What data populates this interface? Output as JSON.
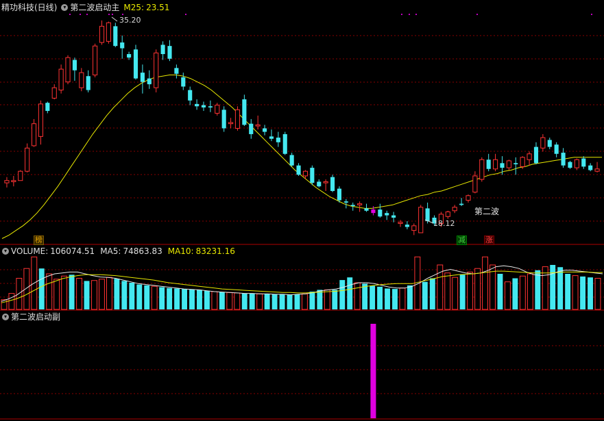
{
  "main_panel": {
    "stock_name": "精功科技(日线)",
    "indicator_name": "第二波启动主",
    "ma25_label": "M25:",
    "ma25_value": "23.51",
    "high_label": "35.20",
    "low_label": "18.12",
    "signal_text": "第二波",
    "tags": {
      "bang": "榜",
      "jian": "减",
      "zhang": "涨"
    }
  },
  "volume_panel": {
    "volume_label": "VOLUME:",
    "volume_value": "106074.51",
    "ma5_label": "MA5:",
    "ma5_value": "74863.83",
    "ma10_label": "MA10:",
    "ma10_value": "83231.16"
  },
  "sub_panel": {
    "indicator_name": "第二波启动副"
  },
  "icons": {
    "panel_toggle": "chevron-down-icon"
  },
  "colors": {
    "up": "#ff3333",
    "down": "#44e8f0",
    "ma_line": "#e8e800",
    "grid": "#8a0000",
    "signal": "#e000e0",
    "tag_bang": "#e0a000",
    "tag_jian": "#40d040",
    "tag_zhang": "#ff4040"
  },
  "chart_data": {
    "type": "candlestick",
    "price_range": [
      17.0,
      36.0
    ],
    "high": 35.2,
    "low": 18.12,
    "ma25_last": 23.51,
    "signal_index": 54,
    "candles": [
      {
        "o": 21.3,
        "h": 21.8,
        "l": 20.9,
        "c": 21.5
      },
      {
        "o": 21.4,
        "h": 21.9,
        "l": 21.0,
        "c": 21.5
      },
      {
        "o": 21.5,
        "h": 22.4,
        "l": 21.5,
        "c": 22.3
      },
      {
        "o": 22.3,
        "h": 24.7,
        "l": 22.2,
        "c": 24.3
      },
      {
        "o": 24.5,
        "h": 26.8,
        "l": 24.4,
        "c": 26.4
      },
      {
        "o": 25.3,
        "h": 28.4,
        "l": 24.6,
        "c": 28.1
      },
      {
        "o": 28.2,
        "h": 28.3,
        "l": 27.3,
        "c": 27.5
      },
      {
        "o": 28.6,
        "h": 29.8,
        "l": 28.5,
        "c": 29.5
      },
      {
        "o": 29.3,
        "h": 31.5,
        "l": 29.0,
        "c": 31.1
      },
      {
        "o": 30.0,
        "h": 32.3,
        "l": 29.8,
        "c": 32.1
      },
      {
        "o": 31.9,
        "h": 32.1,
        "l": 30.1,
        "c": 31.0
      },
      {
        "o": 29.5,
        "h": 31.2,
        "l": 29.2,
        "c": 30.8
      },
      {
        "o": 30.5,
        "h": 31.0,
        "l": 29.1,
        "c": 29.3
      },
      {
        "o": 30.6,
        "h": 33.3,
        "l": 30.4,
        "c": 33.1
      },
      {
        "o": 33.4,
        "h": 35.3,
        "l": 33.2,
        "c": 34.8
      },
      {
        "o": 33.5,
        "h": 35.2,
        "l": 33.3,
        "c": 35.1
      },
      {
        "o": 34.8,
        "h": 35.1,
        "l": 33.0,
        "c": 33.1
      },
      {
        "o": 33.4,
        "h": 34.0,
        "l": 32.0,
        "c": 32.9
      },
      {
        "o": 32.4,
        "h": 32.6,
        "l": 31.9,
        "c": 32.1
      },
      {
        "o": 32.8,
        "h": 33.2,
        "l": 30.2,
        "c": 30.3
      },
      {
        "o": 30.8,
        "h": 31.5,
        "l": 29.0,
        "c": 30.0
      },
      {
        "o": 30.3,
        "h": 31.0,
        "l": 29.4,
        "c": 29.8
      },
      {
        "o": 29.5,
        "h": 32.8,
        "l": 29.1,
        "c": 32.5
      },
      {
        "o": 33.2,
        "h": 33.5,
        "l": 31.9,
        "c": 32.4
      },
      {
        "o": 33.1,
        "h": 33.6,
        "l": 31.8,
        "c": 32.0
      },
      {
        "o": 31.2,
        "h": 31.5,
        "l": 30.3,
        "c": 30.7
      },
      {
        "o": 30.4,
        "h": 30.8,
        "l": 29.3,
        "c": 29.6
      },
      {
        "o": 29.3,
        "h": 29.6,
        "l": 28.0,
        "c": 28.4
      },
      {
        "o": 28.1,
        "h": 28.5,
        "l": 27.6,
        "c": 27.9
      },
      {
        "o": 28.0,
        "h": 28.3,
        "l": 27.5,
        "c": 27.8
      },
      {
        "o": 27.9,
        "h": 28.4,
        "l": 27.4,
        "c": 27.8
      },
      {
        "o": 27.3,
        "h": 28.2,
        "l": 27.1,
        "c": 28.0
      },
      {
        "o": 27.6,
        "h": 27.9,
        "l": 25.7,
        "c": 26.0
      },
      {
        "o": 26.4,
        "h": 26.9,
        "l": 26.0,
        "c": 26.5
      },
      {
        "o": 26.0,
        "h": 27.9,
        "l": 25.8,
        "c": 27.6
      },
      {
        "o": 28.5,
        "h": 28.9,
        "l": 26.2,
        "c": 26.3
      },
      {
        "o": 26.4,
        "h": 26.8,
        "l": 25.1,
        "c": 25.5
      },
      {
        "o": 26.2,
        "h": 27.1,
        "l": 25.9,
        "c": 26.3
      },
      {
        "o": 26.0,
        "h": 26.3,
        "l": 25.4,
        "c": 25.7
      },
      {
        "o": 25.3,
        "h": 25.9,
        "l": 24.9,
        "c": 25.1
      },
      {
        "o": 25.2,
        "h": 25.7,
        "l": 24.4,
        "c": 24.8
      },
      {
        "o": 25.5,
        "h": 25.7,
        "l": 23.7,
        "c": 23.8
      },
      {
        "o": 23.7,
        "h": 23.9,
        "l": 22.7,
        "c": 22.8
      },
      {
        "o": 22.8,
        "h": 23.0,
        "l": 21.9,
        "c": 22.0
      },
      {
        "o": 21.9,
        "h": 22.4,
        "l": 21.6,
        "c": 22.3
      },
      {
        "o": 22.6,
        "h": 22.8,
        "l": 21.1,
        "c": 21.3
      },
      {
        "o": 21.4,
        "h": 21.6,
        "l": 20.9,
        "c": 21.0
      },
      {
        "o": 21.3,
        "h": 21.6,
        "l": 20.6,
        "c": 21.4
      },
      {
        "o": 21.8,
        "h": 22.0,
        "l": 20.5,
        "c": 20.6
      },
      {
        "o": 20.8,
        "h": 21.0,
        "l": 19.6,
        "c": 19.8
      },
      {
        "o": 19.7,
        "h": 19.9,
        "l": 19.1,
        "c": 19.6
      },
      {
        "o": 19.4,
        "h": 19.6,
        "l": 18.9,
        "c": 19.3
      },
      {
        "o": 19.4,
        "h": 19.7,
        "l": 18.8,
        "c": 19.5
      },
      {
        "o": 19.1,
        "h": 19.5,
        "l": 18.8,
        "c": 18.9
      },
      {
        "o": 19.0,
        "h": 19.3,
        "l": 18.5,
        "c": 18.7
      },
      {
        "o": 19.0,
        "h": 19.5,
        "l": 18.3,
        "c": 18.4
      },
      {
        "o": 18.7,
        "h": 18.9,
        "l": 18.1,
        "c": 18.5
      },
      {
        "o": 18.5,
        "h": 18.8,
        "l": 17.9,
        "c": 18.3
      },
      {
        "o": 17.8,
        "h": 18.1,
        "l": 17.5,
        "c": 17.9
      },
      {
        "o": 17.7,
        "h": 18.0,
        "l": 17.3,
        "c": 17.5
      },
      {
        "o": 17.2,
        "h": 17.8,
        "l": 16.8,
        "c": 17.6
      },
      {
        "o": 17.0,
        "h": 19.4,
        "l": 17.0,
        "c": 19.2
      },
      {
        "o": 19.1,
        "h": 19.6,
        "l": 17.8,
        "c": 18.0
      },
      {
        "o": 18.3,
        "h": 18.5,
        "l": 17.6,
        "c": 17.8
      },
      {
        "o": 17.8,
        "h": 18.8,
        "l": 17.5,
        "c": 18.6
      },
      {
        "o": 18.4,
        "h": 18.9,
        "l": 18.2,
        "c": 18.8
      },
      {
        "o": 18.9,
        "h": 19.4,
        "l": 18.7,
        "c": 19.2
      },
      {
        "o": 19.5,
        "h": 20.0,
        "l": 19.3,
        "c": 19.4
      },
      {
        "o": 19.8,
        "h": 20.3,
        "l": 19.6,
        "c": 20.2
      },
      {
        "o": 20.5,
        "h": 22.3,
        "l": 20.4,
        "c": 21.9
      },
      {
        "o": 21.6,
        "h": 23.5,
        "l": 21.4,
        "c": 23.3
      },
      {
        "o": 23.3,
        "h": 23.8,
        "l": 22.3,
        "c": 22.5
      },
      {
        "o": 22.5,
        "h": 23.8,
        "l": 22.3,
        "c": 23.3
      },
      {
        "o": 23.0,
        "h": 23.6,
        "l": 22.0,
        "c": 22.6
      },
      {
        "o": 22.6,
        "h": 23.3,
        "l": 22.4,
        "c": 23.2
      },
      {
        "o": 23.0,
        "h": 23.5,
        "l": 22.0,
        "c": 22.9
      },
      {
        "o": 22.7,
        "h": 23.6,
        "l": 22.5,
        "c": 23.5
      },
      {
        "o": 23.3,
        "h": 24.0,
        "l": 22.8,
        "c": 23.8
      },
      {
        "o": 24.4,
        "h": 24.8,
        "l": 22.9,
        "c": 23.0
      },
      {
        "o": 24.3,
        "h": 25.5,
        "l": 24.0,
        "c": 25.2
      },
      {
        "o": 25.0,
        "h": 25.2,
        "l": 24.2,
        "c": 24.4
      },
      {
        "o": 24.6,
        "h": 24.8,
        "l": 23.5,
        "c": 23.8
      },
      {
        "o": 23.9,
        "h": 24.3,
        "l": 22.6,
        "c": 22.8
      },
      {
        "o": 23.1,
        "h": 23.2,
        "l": 22.5,
        "c": 22.6
      },
      {
        "o": 22.6,
        "h": 23.4,
        "l": 22.4,
        "c": 23.3
      },
      {
        "o": 23.4,
        "h": 23.6,
        "l": 22.5,
        "c": 22.7
      },
      {
        "o": 22.8,
        "h": 23.0,
        "l": 22.3,
        "c": 22.4
      },
      {
        "o": 22.3,
        "h": 23.1,
        "l": 22.2,
        "c": 22.5
      }
    ],
    "ma25": [
      16.5,
      16.8,
      17.2,
      17.6,
      18.1,
      18.7,
      19.4,
      20.2,
      21.0,
      21.9,
      22.8,
      23.7,
      24.6,
      25.5,
      26.3,
      27.1,
      27.8,
      28.4,
      29.0,
      29.5,
      29.9,
      30.2,
      30.4,
      30.5,
      30.6,
      30.6,
      30.5,
      30.3,
      30.0,
      29.7,
      29.3,
      28.8,
      28.3,
      27.8,
      27.2,
      26.6,
      26.0,
      25.4,
      24.8,
      24.2,
      23.6,
      23.0,
      22.4,
      21.9,
      21.4,
      20.9,
      20.5,
      20.1,
      19.8,
      19.5,
      19.3,
      19.2,
      19.1,
      19.1,
      19.2,
      19.3,
      19.4,
      19.6,
      19.8,
      20.0,
      20.2,
      20.3,
      20.5,
      20.6,
      20.8,
      21.0,
      21.2,
      21.4,
      21.6,
      21.8,
      22.0,
      22.1,
      22.3,
      22.4,
      22.6,
      22.7,
      22.9,
      23.0,
      23.1,
      23.2,
      23.3,
      23.4,
      23.5,
      23.51,
      23.5,
      23.5,
      23.5
    ],
    "volume": [
      22,
      36,
      70,
      92,
      118,
      92,
      80,
      68,
      75,
      78,
      70,
      64,
      65,
      68,
      72,
      69,
      64,
      60,
      56,
      54,
      52,
      50,
      48,
      47,
      46,
      45,
      44,
      42,
      40,
      39,
      38,
      37,
      36,
      36,
      35,
      35,
      34,
      34,
      33,
      34,
      35,
      40,
      44,
      44,
      44,
      66,
      72,
      60,
      58,
      53,
      51,
      47,
      46,
      48,
      54,
      118,
      62,
      70,
      100,
      82,
      72,
      78,
      84,
      92,
      118,
      100,
      80,
      62,
      70,
      75,
      80,
      88,
      96,
      100,
      95,
      80,
      76,
      74,
      72,
      70
    ],
    "ma5": [
      18,
      24,
      32,
      44,
      56,
      66,
      74,
      80,
      82,
      84,
      84,
      80,
      76,
      73,
      72,
      70,
      66,
      62,
      58,
      56,
      54,
      52,
      50,
      48,
      46,
      45,
      44,
      42,
      40,
      39,
      38,
      37,
      36,
      36,
      35,
      35,
      34,
      34,
      33,
      34,
      35,
      38,
      42,
      44,
      46,
      50,
      56,
      60,
      60,
      58,
      54,
      50,
      48,
      48,
      52,
      60,
      70,
      78,
      86,
      90,
      86,
      82,
      80,
      82,
      88,
      96,
      98,
      96,
      92,
      84,
      78,
      76,
      78,
      84,
      88,
      88,
      86,
      84,
      82,
      80
    ],
    "ma10": [
      15,
      19,
      24,
      31,
      40,
      49,
      57,
      63,
      69,
      73,
      76,
      78,
      78,
      78,
      77,
      76,
      74,
      72,
      70,
      68,
      66,
      63,
      60,
      58,
      56,
      54,
      52,
      50,
      48,
      46,
      45,
      44,
      43,
      42,
      41,
      40,
      39,
      38,
      38,
      37,
      37,
      38,
      39,
      40,
      41,
      43,
      46,
      49,
      52,
      54,
      56,
      57,
      58,
      58,
      58,
      62,
      66,
      70,
      74,
      76,
      78,
      79,
      80,
      82,
      84,
      86,
      86,
      85,
      84,
      83,
      82,
      82,
      82,
      83,
      84,
      84,
      84,
      84,
      83,
      83
    ]
  }
}
